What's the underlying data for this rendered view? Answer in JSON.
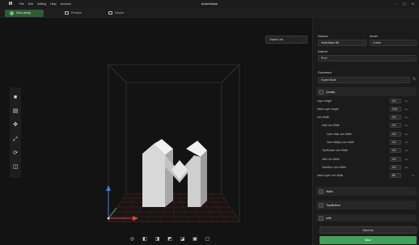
{
  "titlebar": {
    "logo": "M",
    "menu": [
      "File",
      "Edit",
      "Setting",
      "Help",
      "Account"
    ],
    "title": "AnkerMake",
    "minimize": "–",
    "maximize": "▢",
    "close": "✕"
  },
  "tabs": [
    {
      "label": "Slice (beta)",
      "active": true
    },
    {
      "label": "Preview",
      "active": false
    },
    {
      "label": "Device",
      "active": false
    }
  ],
  "viewport": {
    "object_list_label": "Object List"
  },
  "panel": {
    "machine_label": "Machine",
    "machine_value": "AnkerMake M5",
    "nozzle_label": "Nozzle",
    "nozzle_value": "0.4mm",
    "material_label": "Material",
    "material_value": "PLA+",
    "parameters_label": "Parameters",
    "parameters_value": "Expert Mode",
    "quality_title": "Quality",
    "quality_rows": [
      {
        "label": "Layer Height",
        "value": "0.2",
        "unit": "mm",
        "indent": 0
      },
      {
        "label": "Initial Layer Height",
        "value": "0.14",
        "unit": "mm",
        "indent": 0
      },
      {
        "label": "Line Width",
        "value": "0.4",
        "unit": "mm",
        "indent": 0
      },
      {
        "label": "Wall Line Width",
        "value": "0.4",
        "unit": "mm",
        "indent": 1
      },
      {
        "label": "Outer Wall Line Width",
        "value": "0.4",
        "unit": "mm",
        "indent": 2
      },
      {
        "label": "Inner Wall(s) Line Width",
        "value": "0.4",
        "unit": "mm",
        "indent": 2
      },
      {
        "label": "Top/Bottom Line Width",
        "value": "0.4",
        "unit": "mm",
        "indent": 1
      },
      {
        "label": "Infill Line Width",
        "value": "0.4",
        "unit": "mm",
        "indent": 1
      },
      {
        "label": "Skirt/Brim Line Width",
        "value": "0.4",
        "unit": "mm",
        "indent": 1
      },
      {
        "label": "Initial Layer Line Width",
        "value": "80",
        "unit": "%",
        "indent": 0
      }
    ],
    "walls_title": "Walls",
    "topbottom_title": "Top/Bottom",
    "infill_title": "Infill",
    "save_as": "Save As",
    "slice": "Slice"
  }
}
